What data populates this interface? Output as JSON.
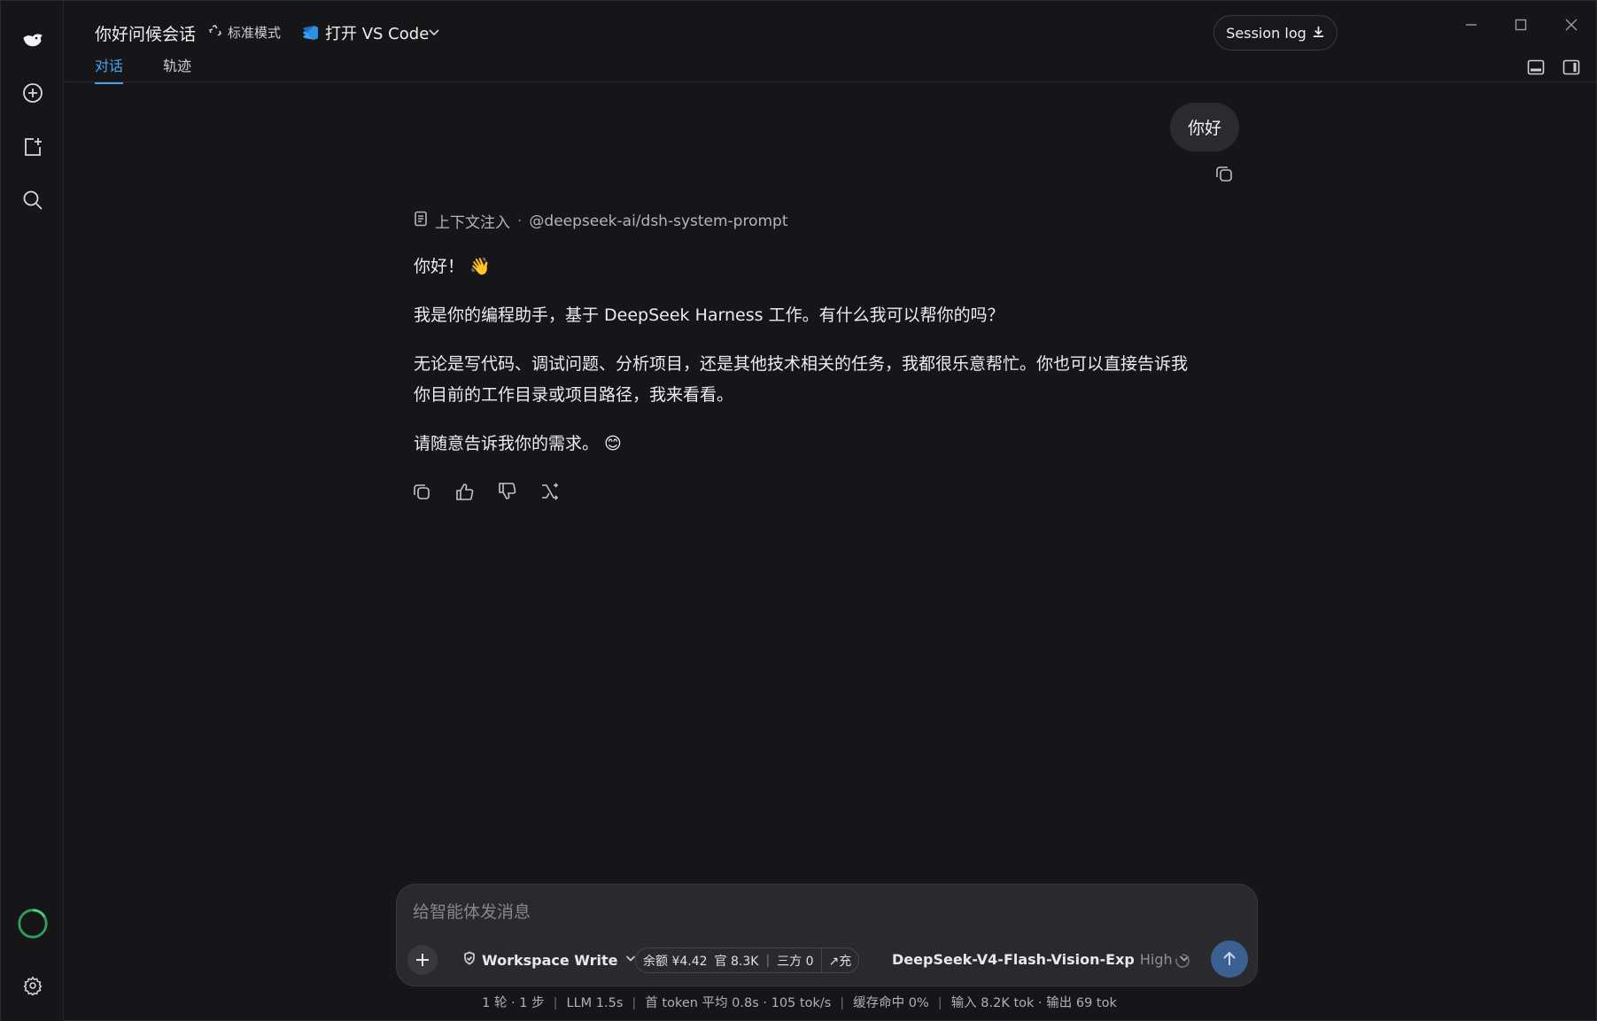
{
  "header": {
    "title": "你好问候会话",
    "mode_label": "标准模式",
    "vscode_label": "打开 VS Code",
    "session_log_label": "Session log",
    "tabs": [
      {
        "label": "对话",
        "active": true
      },
      {
        "label": "轨迹",
        "active": false
      }
    ]
  },
  "rail": {
    "items": [
      "logo-icon",
      "new-chat-icon",
      "new-project-icon",
      "search-icon",
      "usage-ring-icon",
      "settings-icon"
    ]
  },
  "chat": {
    "user_message": "你好",
    "context": {
      "label": "上下文注入",
      "separator": "·",
      "source": "@deepseek-ai/dsh-system-prompt"
    },
    "assistant": {
      "p1": "你好！",
      "p1_emoji": "👋",
      "p2": "我是你的编程助手，基于 DeepSeek Harness 工作。有什么我可以帮你的吗？",
      "p3_line1": "无论是写代码、调试问题、分析项目，还是其他技术相关的任务，我都很乐意帮忙。你也可以直接告诉我",
      "p3_line2": "你目前的工作目录或项目路径，我来看看。",
      "p4": "请随意告诉我你的需求。",
      "p4_emoji": "😊"
    }
  },
  "composer": {
    "placeholder": "给智能体发消息",
    "workspace": "Workspace Write",
    "balance": "余额 ¥4.42",
    "official": "官 8.3K",
    "third_party": "三方 0",
    "recharge": "↗充",
    "model": "DeepSeek-V4-Flash-Vision-Exp",
    "level": "High"
  },
  "status": {
    "turns": "1 轮 · 1 步",
    "llm": "LLM 1.5s",
    "first_token": "首 token 平均 0.8s · 105 tok/s",
    "cache": "缓存命中 0%",
    "io": "输入 8.2K tok · 输出 69 tok"
  },
  "colors": {
    "accent": "#4aa3f0",
    "send_button": "#3c5f92",
    "background": "#161618"
  }
}
